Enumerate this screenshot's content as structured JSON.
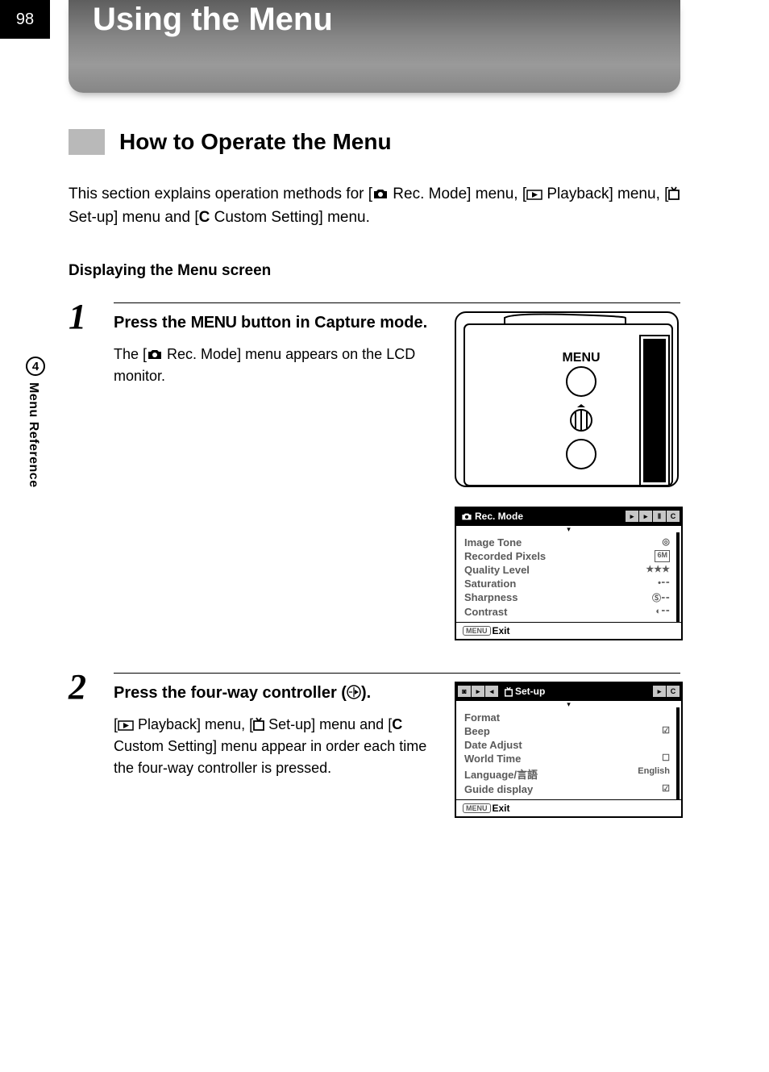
{
  "page_number": "98",
  "title": "Using the Menu",
  "section_heading": "How to Operate the Menu",
  "intro_parts": {
    "a": "This section explains operation methods for [",
    "b": " Rec. Mode] menu, [",
    "c": " Playback] menu, [",
    "d": " Set-up] menu and [",
    "e": " Custom Setting] menu."
  },
  "icons": {
    "custom_c": "C"
  },
  "subsection": "Displaying the Menu screen",
  "side_tab": {
    "number": "4",
    "label": "Menu Reference"
  },
  "steps": [
    {
      "num": "1",
      "heading_a": "Press the ",
      "heading_menu": "MENU",
      "heading_b": " button in Capture mode.",
      "desc_a": "The [",
      "desc_b": " Rec. Mode] menu appears on the LCD monitor.",
      "diagram_label": "MENU",
      "lcd": {
        "tab_label": "Rec. Mode",
        "tab_icons": [
          "▶",
          "▸",
          "C"
        ],
        "items": [
          {
            "label": "Image Tone",
            "value": "◎"
          },
          {
            "label": "Recorded Pixels",
            "value": "6M"
          },
          {
            "label": "Quality Level",
            "value": "★★★"
          },
          {
            "label": "Saturation",
            "value": "•⁃⁃"
          },
          {
            "label": "Sharpness",
            "value": "Ⓢ⁃⁃"
          },
          {
            "label": "Contrast",
            "value": "◐⁃⁃"
          }
        ],
        "exit_prefix": "MENU",
        "exit": "Exit"
      }
    },
    {
      "num": "2",
      "heading": "Press the four-way controller (  ).",
      "desc_a": "[",
      "desc_b": " Playback] menu, [",
      "desc_c": " Set-up] menu and [",
      "desc_d": " Custom Setting] menu appear in order each time the four-way controller is pressed.",
      "lcd": {
        "tab_prefix_icons": [
          "◀"
        ],
        "tab_label": "Set-up",
        "tab_icons": [
          "C"
        ],
        "items": [
          {
            "label": "Format",
            "value": ""
          },
          {
            "label": "Beep",
            "value": "☑"
          },
          {
            "label": "Date Adjust",
            "value": ""
          },
          {
            "label": "World Time",
            "value": "☐"
          },
          {
            "label": "Language/言語",
            "value": "English"
          },
          {
            "label": "Guide display",
            "value": "☑"
          }
        ],
        "exit_prefix": "MENU",
        "exit": "Exit"
      }
    }
  ]
}
